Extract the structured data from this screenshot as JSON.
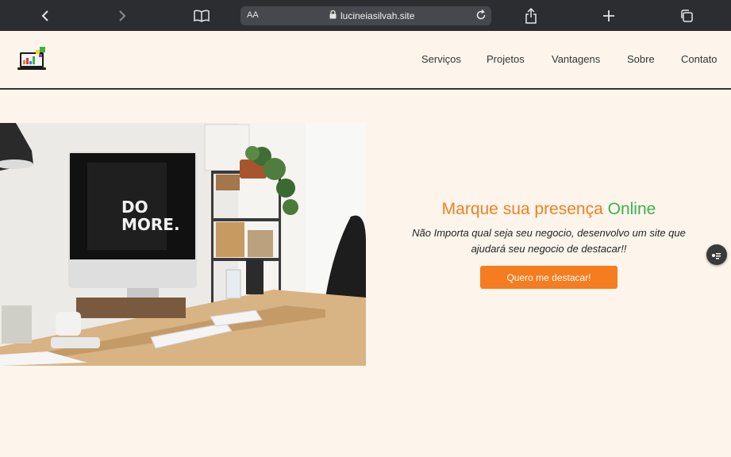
{
  "browser": {
    "text_size_label": "AA",
    "url": "lucineiasilvah.site",
    "icons": [
      "back-icon",
      "forward-icon",
      "bookmarks-icon",
      "lock-icon",
      "reload-icon",
      "share-icon",
      "new-tab-icon",
      "tabs-icon"
    ]
  },
  "nav": {
    "items": [
      "Serviços",
      "Projetos",
      "Vantagens",
      "Sobre",
      "Contato"
    ]
  },
  "hero": {
    "headline_main": "Marque sua presença ",
    "headline_accent": "Online",
    "line1": "Não Importa qual seja seu negocio, desenvolvo um site que",
    "line2": "ajudará seu negocio de destacar!!",
    "cta_label": "Quero me destacar!",
    "photo_text_line1": "DO",
    "photo_text_line2": "MORE."
  },
  "colors": {
    "page_bg": "#fdf5ec",
    "accent_orange": "#f07f22",
    "accent_green": "#3db24b",
    "button_bg": "#f57c1f",
    "chrome_bg": "#2b2d31"
  }
}
